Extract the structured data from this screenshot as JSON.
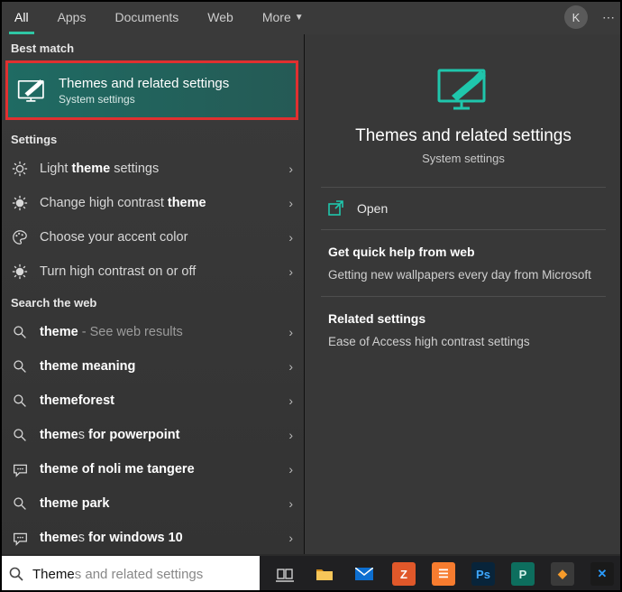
{
  "tabs": {
    "items": [
      {
        "label": "All",
        "active": true
      },
      {
        "label": "Apps"
      },
      {
        "label": "Documents"
      },
      {
        "label": "Web"
      },
      {
        "label": "More",
        "dropdown": true
      }
    ],
    "avatar_letter": "K"
  },
  "left": {
    "best_match_label": "Best match",
    "best_match": {
      "title": "Themes and related settings",
      "subtitle": "System settings"
    },
    "settings_label": "Settings",
    "settings": [
      {
        "icon": "sun",
        "html": "Light <b>theme</b> settings"
      },
      {
        "icon": "contrast",
        "html": "Change high contrast <b>theme</b>"
      },
      {
        "icon": "palette",
        "html": "Choose your accent color"
      },
      {
        "icon": "contrast",
        "html": "Turn high contrast on or off"
      }
    ],
    "web_label": "Search the web",
    "web": [
      {
        "icon": "search",
        "html": "<b>theme</b><span class='dimmed'> - See web results</span>"
      },
      {
        "icon": "search",
        "html": "<b>theme</b> <b>meaning</b>"
      },
      {
        "icon": "search",
        "html": "<b>theme</b><b>forest</b>"
      },
      {
        "icon": "search",
        "html": "<b>theme</b>s <b>for powerpoint</b>"
      },
      {
        "icon": "chat",
        "html": "<b>theme</b> <b>of noli me tangere</b>"
      },
      {
        "icon": "search",
        "html": "<b>theme</b> <b>park</b>"
      },
      {
        "icon": "chat",
        "html": "<b>theme</b>s <b>for windows 10</b>"
      }
    ]
  },
  "right": {
    "title": "Themes and related settings",
    "subtitle": "System settings",
    "open": "Open",
    "help_head": "Get quick help from web",
    "help_text": "Getting new wallpapers every day from Microsoft",
    "related_head": "Related settings",
    "related_text": "Ease of Access high contrast settings"
  },
  "search": {
    "typed": "Theme",
    "completion": "s and related settings"
  },
  "taskbar_icons": [
    {
      "name": "task-view",
      "type": "svg"
    },
    {
      "name": "file-explorer",
      "bg": "#f7c659",
      "fg": "#d18b18"
    },
    {
      "name": "mail",
      "bg": "#0d6fd1",
      "fg": "#fff"
    },
    {
      "name": "app-z",
      "bg": "#e0582a",
      "fg": "#fff",
      "letter": "Z"
    },
    {
      "name": "xampp",
      "bg": "#f77c2f",
      "fg": "#fff"
    },
    {
      "name": "photoshop",
      "bg": "#08243a",
      "fg": "#3ea8ff",
      "letter": "Ps"
    },
    {
      "name": "publisher",
      "bg": "#0d6e5e",
      "fg": "#d6f3ec",
      "letter": "P"
    },
    {
      "name": "sublime",
      "bg": "#3a3a3a",
      "fg": "#f79b2a"
    },
    {
      "name": "app-blue",
      "bg": "#1a1a1a",
      "fg": "#2a9cff"
    }
  ]
}
